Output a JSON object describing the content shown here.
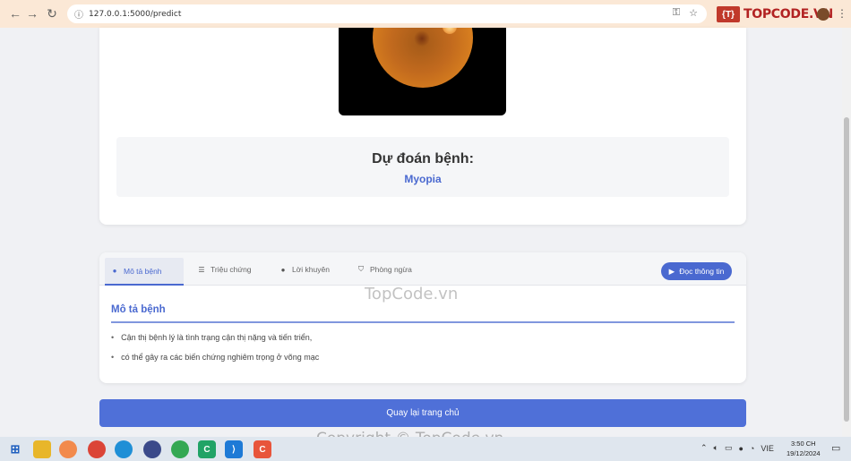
{
  "browser": {
    "url": "127.0.0.1:5000/predict",
    "brand_logo": "TOPCODE.VN"
  },
  "result": {
    "title": "Dự đoán bệnh:",
    "value": "Myopia"
  },
  "tabs": [
    {
      "label": "Mô tả bệnh",
      "icon": "info-icon",
      "active": true
    },
    {
      "label": "Triệu chứng",
      "icon": "list-icon",
      "active": false
    },
    {
      "label": "Lời khuyên",
      "icon": "chat-icon",
      "active": false
    },
    {
      "label": "Phòng ngừa",
      "icon": "shield-icon",
      "active": false
    }
  ],
  "read_button": "Đọc thông tin",
  "section": {
    "title": "Mô tả bệnh",
    "bullets": [
      "Cận thị bệnh lý là tình trạng cận thị nặng và tiến triển,",
      "có thể gây ra các biến chứng nghiêm trọng ở võng mạc"
    ]
  },
  "back_button": "Quay lại trang chủ",
  "watermarks": {
    "center": "TopCode.vn",
    "bottom": "Copyright © TopCode.vn"
  },
  "taskbar": {
    "language": "VIE",
    "time": "3:50 CH",
    "date": "19/12/2024"
  },
  "colors": {
    "accent": "#4a69d0",
    "browser_bar": "#fbe8d6"
  }
}
